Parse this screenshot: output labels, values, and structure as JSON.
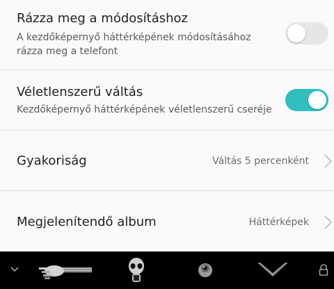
{
  "settings": {
    "shake": {
      "title": "Rázza meg a módosításhoz",
      "subtitle": "A kezdőképernyő háttérképének módosításához rázza meg a telefont",
      "enabled": false
    },
    "random": {
      "title": "Véletlenszerű váltás",
      "subtitle": "Kezdőképernyő háttérképének véletlenszerű cseréje",
      "enabled": true
    },
    "frequency": {
      "title": "Gyakoriság",
      "value": "Váltás 5 percenként"
    },
    "album": {
      "title": "Megjelenítendő album",
      "value": "Háttérképek"
    }
  },
  "bottom_bar": {
    "items": [
      "chevron-down-icon",
      "hand-wallpaper-thumb",
      "skull-wallpaper-thumb",
      "eye-wallpaper-thumb",
      "chevron-logo-wallpaper-thumb",
      "lock-icon"
    ]
  },
  "colors": {
    "accent": "#32bdbf",
    "toggle_off": "#e6e6e6",
    "background": "#fafafa",
    "bottom_bar": "#000000"
  }
}
